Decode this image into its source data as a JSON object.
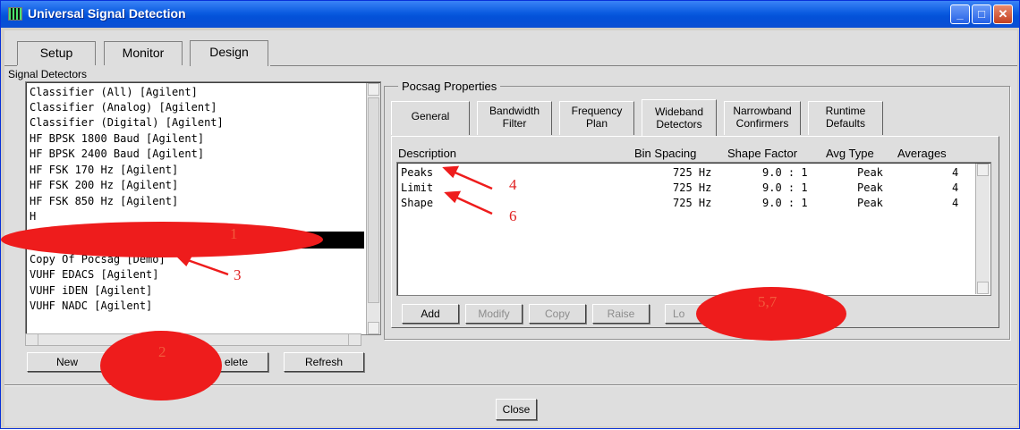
{
  "window": {
    "title": "Universal Signal Detection",
    "controls": [
      "minimize",
      "maximize",
      "close"
    ]
  },
  "tabs": [
    {
      "label": "Setup",
      "active": false
    },
    {
      "label": "Monitor",
      "active": false
    },
    {
      "label": "Design",
      "active": true
    }
  ],
  "detectors": {
    "label": "Signal Detectors",
    "items": [
      "Classifier (All) [Agilent]",
      "Classifier (Analog) [Agilent]",
      "Classifier (Digital) [Agilent]",
      "HF BPSK 1800 Baud [Agilent]",
      "HF BPSK 2400 Baud [Agilent]",
      "HF FSK 170 Hz [Agilent]",
      "HF FSK 200 Hz [Agilent]",
      "HF FSK 850 Hz [Agilent]",
      "H",
      "",
      "Copy Of Pocsag [Demo]",
      "VUHF EDACS [Agilent]",
      "VUHF iDEN [Agilent]",
      "VUHF NADC [Agilent]"
    ],
    "buttons": {
      "new": "New",
      "delete": "elete",
      "refresh": "Refresh"
    }
  },
  "properties": {
    "group_label": "Pocsag Properties",
    "tabs": [
      "General",
      "Bandwidth\nFilter",
      "Frequency\nPlan",
      "Wideband\nDetectors",
      "Narrowband\nConfirmers",
      "Runtime\nDefaults"
    ],
    "active_tab": "Wideband Detectors",
    "columns": [
      "Description",
      "Bin Spacing",
      "Shape Factor",
      "Avg Type",
      "Averages"
    ],
    "rows": [
      {
        "description": "Peaks",
        "bin_spacing": "725 Hz",
        "shape_factor": "9.0 : 1",
        "avg_type": "Peak",
        "averages": "4"
      },
      {
        "description": "Limit",
        "bin_spacing": "725 Hz",
        "shape_factor": "9.0 : 1",
        "avg_type": "Peak",
        "averages": "4"
      },
      {
        "description": "Shape",
        "bin_spacing": "725 Hz",
        "shape_factor": "9.0 : 1",
        "avg_type": "Peak",
        "averages": "4"
      }
    ],
    "buttons": {
      "add": "Add",
      "modify": "Modify",
      "copy": "Copy",
      "raise": "Raise",
      "lower": "Lo"
    }
  },
  "footer": {
    "close": "Close"
  },
  "annotations": {
    "labels": [
      "1",
      "2",
      "3",
      "4",
      "5,7",
      "6"
    ],
    "color": "#ee1c1c"
  }
}
